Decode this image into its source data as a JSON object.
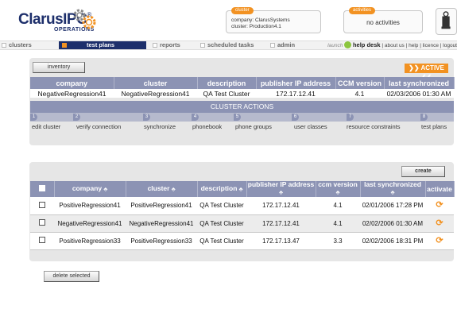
{
  "logo": {
    "main": "ClarusIPC",
    "registered": "®",
    "sub": "OPERATIONS"
  },
  "cluster_box": {
    "tag": "cluster",
    "company_line": "company: ClarusSystems",
    "cluster_line": "cluster: Production4.1"
  },
  "activities_box": {
    "tag": "activities",
    "value": "no activities"
  },
  "nav": {
    "tabs": [
      {
        "label": "clusters"
      },
      {
        "label": "test plans"
      },
      {
        "label": "reports"
      },
      {
        "label": "scheduled tasks"
      },
      {
        "label": "admin"
      }
    ],
    "launch": "launch",
    "help_desk": "help desk",
    "links": [
      "about us",
      "help",
      "licence",
      "logout"
    ]
  },
  "inventory": {
    "button": "inventory",
    "status": "ACTIVE",
    "status_prefix": "❯❯",
    "status_suffix": "❮❮",
    "headers": [
      "company",
      "cluster",
      "description",
      "publisher IP address",
      "CCM version",
      "last synchronized"
    ],
    "row": [
      "NegativeRegression41",
      "NegativeRegression41",
      "QA Test Cluster",
      "172.17.12.41",
      "4.1",
      "02/03/2006 01:30 AM"
    ]
  },
  "cluster_actions": {
    "title": "CLUSTER ACTIONS",
    "items": [
      {
        "num": "1",
        "label": "edit cluster"
      },
      {
        "num": "2",
        "label": "verify connection"
      },
      {
        "num": "3",
        "label": "synchronize"
      },
      {
        "num": "4",
        "label": "phonebook"
      },
      {
        "num": "5",
        "label": "phone groups"
      },
      {
        "num": "6",
        "label": "user classes"
      },
      {
        "num": "7",
        "label": "resource constraints"
      },
      {
        "num": "8",
        "label": "test plans"
      }
    ]
  },
  "test_plans": {
    "create_button": "create",
    "delete_button": "delete selected",
    "sort_glyph": "⬘",
    "headers": [
      "company",
      "cluster",
      "description",
      "publisher IP address",
      "ccm version",
      "last synchronized",
      "activate"
    ],
    "rows": [
      {
        "company": "PositiveRegression41",
        "cluster": "PositiveRegression41",
        "description": "QA Test Cluster",
        "ip": "172.17.12.41",
        "ccm": "4.1",
        "sync": "02/01/2006 17:28 PM"
      },
      {
        "company": "NegativeRegression41",
        "cluster": "NegativeRegression41",
        "description": "QA Test Cluster",
        "ip": "172.17.12.41",
        "ccm": "4.1",
        "sync": "02/02/2006 01:30 AM"
      },
      {
        "company": "PositiveRegression33",
        "cluster": "PositiveRegression33",
        "description": "QA Test Cluster",
        "ip": "172.17.13.47",
        "ccm": "3.3",
        "sync": "02/02/2006 18:31 PM"
      }
    ]
  },
  "colors": {
    "brand_navy": "#1d2f6b",
    "accent_orange": "#f29222",
    "table_header": "#8c93b4",
    "panel_bg": "#e6e6e6",
    "help_green": "#8cc63f"
  },
  "icons": {
    "logo_gear": "gear-icon",
    "lock": "lock-icon",
    "help_desk": "help-desk-icon",
    "activate": "refresh-icon"
  }
}
